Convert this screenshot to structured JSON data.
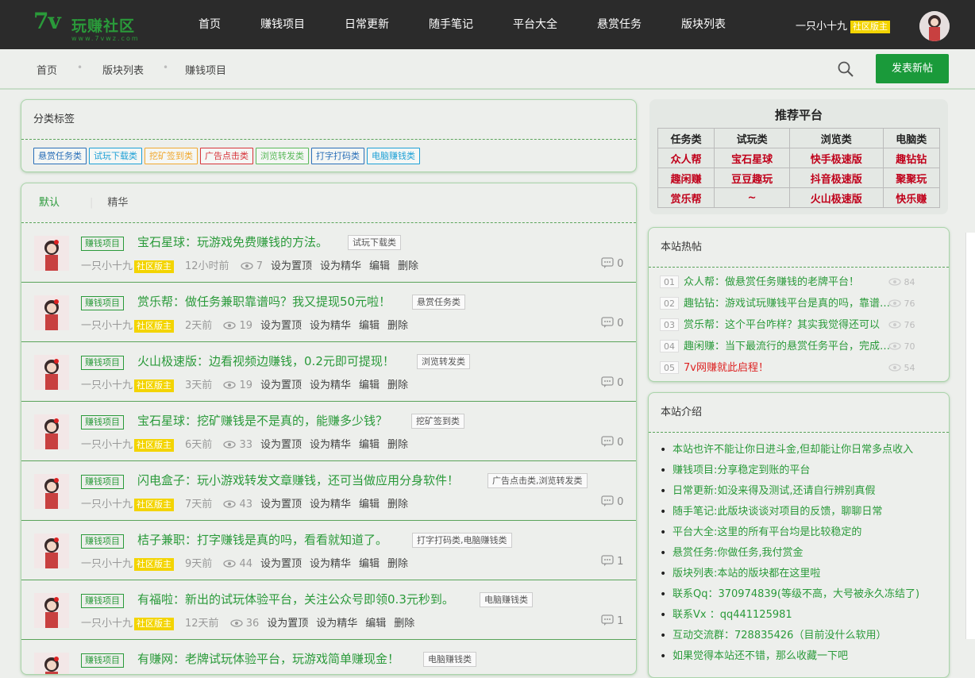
{
  "logo": {
    "big": "7v",
    "cn": "玩赚社区",
    "url": "www.7vwz.com"
  },
  "nav": [
    "首页",
    "赚钱项目",
    "日常更新",
    "随手笔记",
    "平台大全",
    "悬赏任务",
    "版块列表"
  ],
  "user": {
    "name": "一只小十九",
    "badge": "社区版主"
  },
  "breadcrumb": [
    "首页",
    "版块列表",
    "赚钱项目"
  ],
  "post_button": "发表新帖",
  "category": {
    "title": "分类标签",
    "tags": [
      {
        "label": "悬赏任务类",
        "color": "#2a6fb8"
      },
      {
        "label": "试玩下载类",
        "color": "#1ea0d6"
      },
      {
        "label": "挖矿签到类",
        "color": "#f0a830"
      },
      {
        "label": "广告点击类",
        "color": "#d6343a"
      },
      {
        "label": "浏览转发类",
        "color": "#5ab95a"
      },
      {
        "label": "打字打码类",
        "color": "#2a6fb8"
      },
      {
        "label": "电脑赚钱类",
        "color": "#1ea0d6"
      }
    ]
  },
  "tabs": [
    "默认",
    "精华"
  ],
  "actions": [
    "设为置顶",
    "设为精华",
    "编辑",
    "删除"
  ],
  "posts": [
    {
      "cat": "赚钱项目",
      "title": "宝石星球：玩游戏免费赚钱的方法。",
      "tag": "试玩下载类",
      "author": "一只小十九",
      "badge": "社区版主",
      "time": "12小时前",
      "views": "7",
      "comments": "0"
    },
    {
      "cat": "赚钱项目",
      "title": "赏乐帮：做任务兼职靠谱吗？我又提现50元啦！",
      "tag": "悬赏任务类",
      "author": "一只小十九",
      "badge": "社区版主",
      "time": "2天前",
      "views": "19",
      "comments": "0"
    },
    {
      "cat": "赚钱项目",
      "title": "火山极速版：边看视频边赚钱，0.2元即可提现！",
      "tag": "浏览转发类",
      "author": "一只小十九",
      "badge": "社区版主",
      "time": "3天前",
      "views": "19",
      "comments": "0"
    },
    {
      "cat": "赚钱项目",
      "title": "宝石星球：挖矿赚钱是不是真的，能赚多少钱？",
      "tag": "挖矿签到类",
      "author": "一只小十九",
      "badge": "社区版主",
      "time": "6天前",
      "views": "33",
      "comments": "0"
    },
    {
      "cat": "赚钱项目",
      "title": "闪电盒子：玩小游戏转发文章赚钱，还可当做应用分身软件！",
      "tag": "广告点击类,浏览转发类",
      "author": "一只小十九",
      "badge": "社区版主",
      "time": "7天前",
      "views": "43",
      "comments": "0"
    },
    {
      "cat": "赚钱项目",
      "title": "桔子兼职：打字赚钱是真的吗，看看就知道了。",
      "tag": "打字打码类,电脑赚钱类",
      "author": "一只小十九",
      "badge": "社区版主",
      "time": "9天前",
      "views": "44",
      "comments": "1"
    },
    {
      "cat": "赚钱项目",
      "title": "有福啦：新出的试玩体验平台，关注公众号即领0.3元秒到。",
      "tag": "电脑赚钱类",
      "author": "一只小十九",
      "badge": "社区版主",
      "time": "12天前",
      "views": "36",
      "comments": "1"
    },
    {
      "cat": "赚钱项目",
      "title": "有赚网：老牌试玩体验平台，玩游戏简单赚现金！",
      "tag": "电脑赚钱类",
      "author": "一只小十九",
      "badge": "社区版主",
      "time": "",
      "views": "",
      "comments": ""
    }
  ],
  "recommend": {
    "title": "推荐平台",
    "headers": [
      "任务类",
      "试玩类",
      "浏览类",
      "电脑类"
    ],
    "rows": [
      [
        "众人帮",
        "宝石星球",
        "快手极速版",
        "趣钻钻"
      ],
      [
        "趣闲赚",
        "豆豆趣玩",
        "抖音极速版",
        "聚聚玩"
      ],
      [
        "赏乐帮",
        "~",
        "火山极速版",
        "快乐赚"
      ]
    ]
  },
  "hot": {
    "title": "本站热帖",
    "items": [
      {
        "num": "01",
        "text": "众人帮：做悬赏任务赚钱的老牌平台！",
        "views": "84",
        "red": false
      },
      {
        "num": "02",
        "text": "趣钻钻：游戏试玩赚钱平台是真的吗，靠谱吗？",
        "views": "76",
        "red": false
      },
      {
        "num": "03",
        "text": "赏乐帮：这个平台咋样？其实我觉得还可以",
        "views": "76",
        "red": false
      },
      {
        "num": "04",
        "text": "趣闲赚：当下最流行的悬赏任务平台，完成任务",
        "views": "70",
        "red": false
      },
      {
        "num": "05",
        "text": "7v网赚就此启程！",
        "views": "54",
        "red": true
      }
    ]
  },
  "intro": {
    "title": "本站介绍",
    "items": [
      "本站也许不能让你日进斗金,但却能让你日常多点收入",
      "赚钱项目:分享稳定到账的平台",
      "日常更新:如没来得及测试,还请自行辨别真假",
      "随手笔记:此版块谈谈对项目的反馈，聊聊日常",
      "平台大全:这里的所有平台均是比较稳定的",
      "悬赏任务:你做任务,我付赏金",
      "版块列表:本站的版块都在这里啦",
      "联系Qq：370974839(等级不高，大号被永久冻结了)",
      "联系Vx ：qq441125981",
      "互动交流群：728835426（目前没什么软用）",
      "如果觉得本站还不错，那么收藏一下吧"
    ]
  }
}
